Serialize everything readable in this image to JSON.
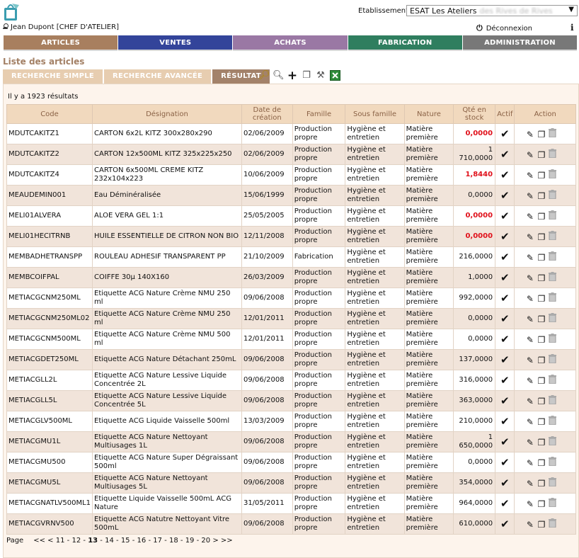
{
  "header": {
    "establishment_label": "Etablissement",
    "establishment_value": "ESAT Les Ateliers",
    "establishment_value_blurred": "des Rives de Rives",
    "user": "Jean Dupont [CHEF D'ATELIER]",
    "logout": "Déconnexion"
  },
  "nav": [
    {
      "label": "ARTICLES",
      "color": "#a87f5f"
    },
    {
      "label": "VENTES",
      "color": "#33449a"
    },
    {
      "label": "ACHATS",
      "color": "#9a78a4"
    },
    {
      "label": "FABRICATION",
      "color": "#2f7e5f"
    },
    {
      "label": "ADMINISTRATION",
      "color": "#787878"
    }
  ],
  "page": {
    "title": "Liste des articles",
    "tabs": [
      "RECHERCHE SIMPLE",
      "RECHERCHE AVANCÉE",
      "RÉSULTAT"
    ],
    "active_tab": "RÉSULTAT",
    "results_text": "Il y a 1923 résultats"
  },
  "table": {
    "headers": [
      "Code",
      "Désignation",
      "Date de création",
      "Famille",
      "Sous famille",
      "Nature",
      "Qté en stock",
      "Actif",
      "Action"
    ],
    "rows": [
      {
        "code": "MDUTCAKITZ1",
        "designation": "CARTON 6x2L KITZ 300x280x290",
        "date": "02/06/2009",
        "famille": "Production propre",
        "sous_famille": "Hygiène et entretien",
        "nature": "Matière première",
        "qty": "0,0000",
        "negative": true
      },
      {
        "code": "MDUTCAKITZ2",
        "designation": "CARTON 12x500ML KITZ 325x225x250",
        "date": "02/06/2009",
        "famille": "Production propre",
        "sous_famille": "Hygiène et entretien",
        "nature": "Matière première",
        "qty": "1 710,0000",
        "negative": false
      },
      {
        "code": "MDUTCAKITZ4",
        "designation": "CARTON 6x500ML CREME KITZ 232x104x223",
        "date": "10/06/2009",
        "famille": "Production propre",
        "sous_famille": "Hygiène et entretien",
        "nature": "Matière première",
        "qty": "1,8440",
        "negative": true
      },
      {
        "code": "MEAUDEMIN001",
        "designation": "Eau Déminéralisée",
        "date": "15/06/1999",
        "famille": "Production propre",
        "sous_famille": "Hygiène et entretien",
        "nature": "Matière première",
        "qty": "0,0000",
        "negative": false
      },
      {
        "code": "MELI01ALVERA",
        "designation": "ALOE VERA GEL 1:1",
        "date": "25/05/2005",
        "famille": "Production propre",
        "sous_famille": "Hygiène et entretien",
        "nature": "Matière première",
        "qty": "0,0000",
        "negative": true
      },
      {
        "code": "MELI01HECITRNB",
        "designation": "HUILE ESSENTIELLE DE CITRON NON BIO",
        "date": "12/11/2008",
        "famille": "Production propre",
        "sous_famille": "Hygiène et entretien",
        "nature": "Matière première",
        "qty": "0,0000",
        "negative": true
      },
      {
        "code": "MEMBADHETRANSPP",
        "designation": "ROULEAU ADHESIF TRANSPARENT PP",
        "date": "21/10/2009",
        "famille": "Fabrication",
        "sous_famille": "Hygiène et entretien",
        "nature": "Matière première",
        "qty": "216,0000",
        "negative": false
      },
      {
        "code": "MEMBCOIFPAL",
        "designation": "COIFFE 30µ 140X160",
        "date": "26/03/2009",
        "famille": "Production propre",
        "sous_famille": "Hygiène et entretien",
        "nature": "Matière première",
        "qty": "1,0000",
        "negative": false
      },
      {
        "code": "METIACGCNM250ML",
        "designation": "Etiquette ACG Nature Crème NMU 250 ml",
        "date": "09/06/2008",
        "famille": "Production propre",
        "sous_famille": "Hygiène et entretien",
        "nature": "Matière première",
        "qty": "992,0000",
        "negative": false
      },
      {
        "code": "METIACGCNM250ML02",
        "designation": "Etiquette ACG Nature Crème NMU 250 ml",
        "date": "12/01/2011",
        "famille": "Production propre",
        "sous_famille": "Hygiène et entretien",
        "nature": "Matière première",
        "qty": "0,0000",
        "negative": false
      },
      {
        "code": "METIACGCNM500ML",
        "designation": "Etiquette ACG Nature Crème NMU 500 ml",
        "date": "12/01/2011",
        "famille": "Production propre",
        "sous_famille": "Hygiène et entretien",
        "nature": "Matière première",
        "qty": "0,0000",
        "negative": false
      },
      {
        "code": "METIACGDET250ML",
        "designation": "Etiquette ACG Nature Détachant 250mL",
        "date": "09/06/2008",
        "famille": "Production propre",
        "sous_famille": "Hygiène et entretien",
        "nature": "Matière première",
        "qty": "137,0000",
        "negative": false
      },
      {
        "code": "METIACGLL2L",
        "designation": "Etiquette ACG Nature Lessive Liquide Concentrée 2L",
        "date": "09/06/2008",
        "famille": "Production propre",
        "sous_famille": "Hygiène et entretien",
        "nature": "Matière première",
        "qty": "316,0000",
        "negative": false
      },
      {
        "code": "METIACGLL5L",
        "designation": "Etiquette ACG Nature Lessive Liquide Concentrée 5L",
        "date": "09/06/2008",
        "famille": "Production propre",
        "sous_famille": "Hygiène et entretien",
        "nature": "Matière première",
        "qty": "363,0000",
        "negative": false
      },
      {
        "code": "METIACGLV500ML",
        "designation": "Etiquette ACG Liquide Vaisselle 500ml",
        "date": "13/03/2009",
        "famille": "Production propre",
        "sous_famille": "Hygiène et entretien",
        "nature": "Matière première",
        "qty": "210,0000",
        "negative": false
      },
      {
        "code": "METIACGMU1L",
        "designation": "Etiquette ACG Nature Nettoyant Multiusages 1L",
        "date": "09/06/2008",
        "famille": "Production propre",
        "sous_famille": "Hygiène et entretien",
        "nature": "Matière première",
        "qty": "1 650,0000",
        "negative": false
      },
      {
        "code": "METIACGMU500",
        "designation": "Etiquette ACG Nature Super Dégraissant 500ml",
        "date": "09/06/2008",
        "famille": "Production propre",
        "sous_famille": "Hygiène et entretien",
        "nature": "Matière première",
        "qty": "0,0000",
        "negative": false
      },
      {
        "code": "METIACGMU5L",
        "designation": "Etiquette ACG Nature Nettoyant Multiusages 5L",
        "date": "09/06/2008",
        "famille": "Production propre",
        "sous_famille": "Hygiène et entretien",
        "nature": "Matière première",
        "qty": "354,0000",
        "negative": false
      },
      {
        "code": "METIACGNATLV500ML1",
        "designation": "Etiquette Liquide Vaisselle 500mL ACG Nature",
        "date": "31/05/2011",
        "famille": "Production propre",
        "sous_famille": "Hygiène et entretien",
        "nature": "Matière première",
        "qty": "964,0000",
        "negative": false
      },
      {
        "code": "METIACGVRNV500",
        "designation": "Etiquette ACG Natutre Nettoyant Vitre 500mL",
        "date": "09/06/2008",
        "famille": "Production propre",
        "sous_famille": "Hygiène et entretien",
        "nature": "Matière première",
        "qty": "610,0000",
        "negative": false
      }
    ]
  },
  "pagination": {
    "label": "Page",
    "first": "<<",
    "prev": "<",
    "pages": [
      "11",
      "12",
      "13",
      "14",
      "15",
      "16",
      "17",
      "18",
      "19",
      "20"
    ],
    "current": "13",
    "next": ">",
    "last": ">>"
  },
  "colors": {
    "accent_title": "#a38065",
    "negative_qty": "#e0101a"
  }
}
